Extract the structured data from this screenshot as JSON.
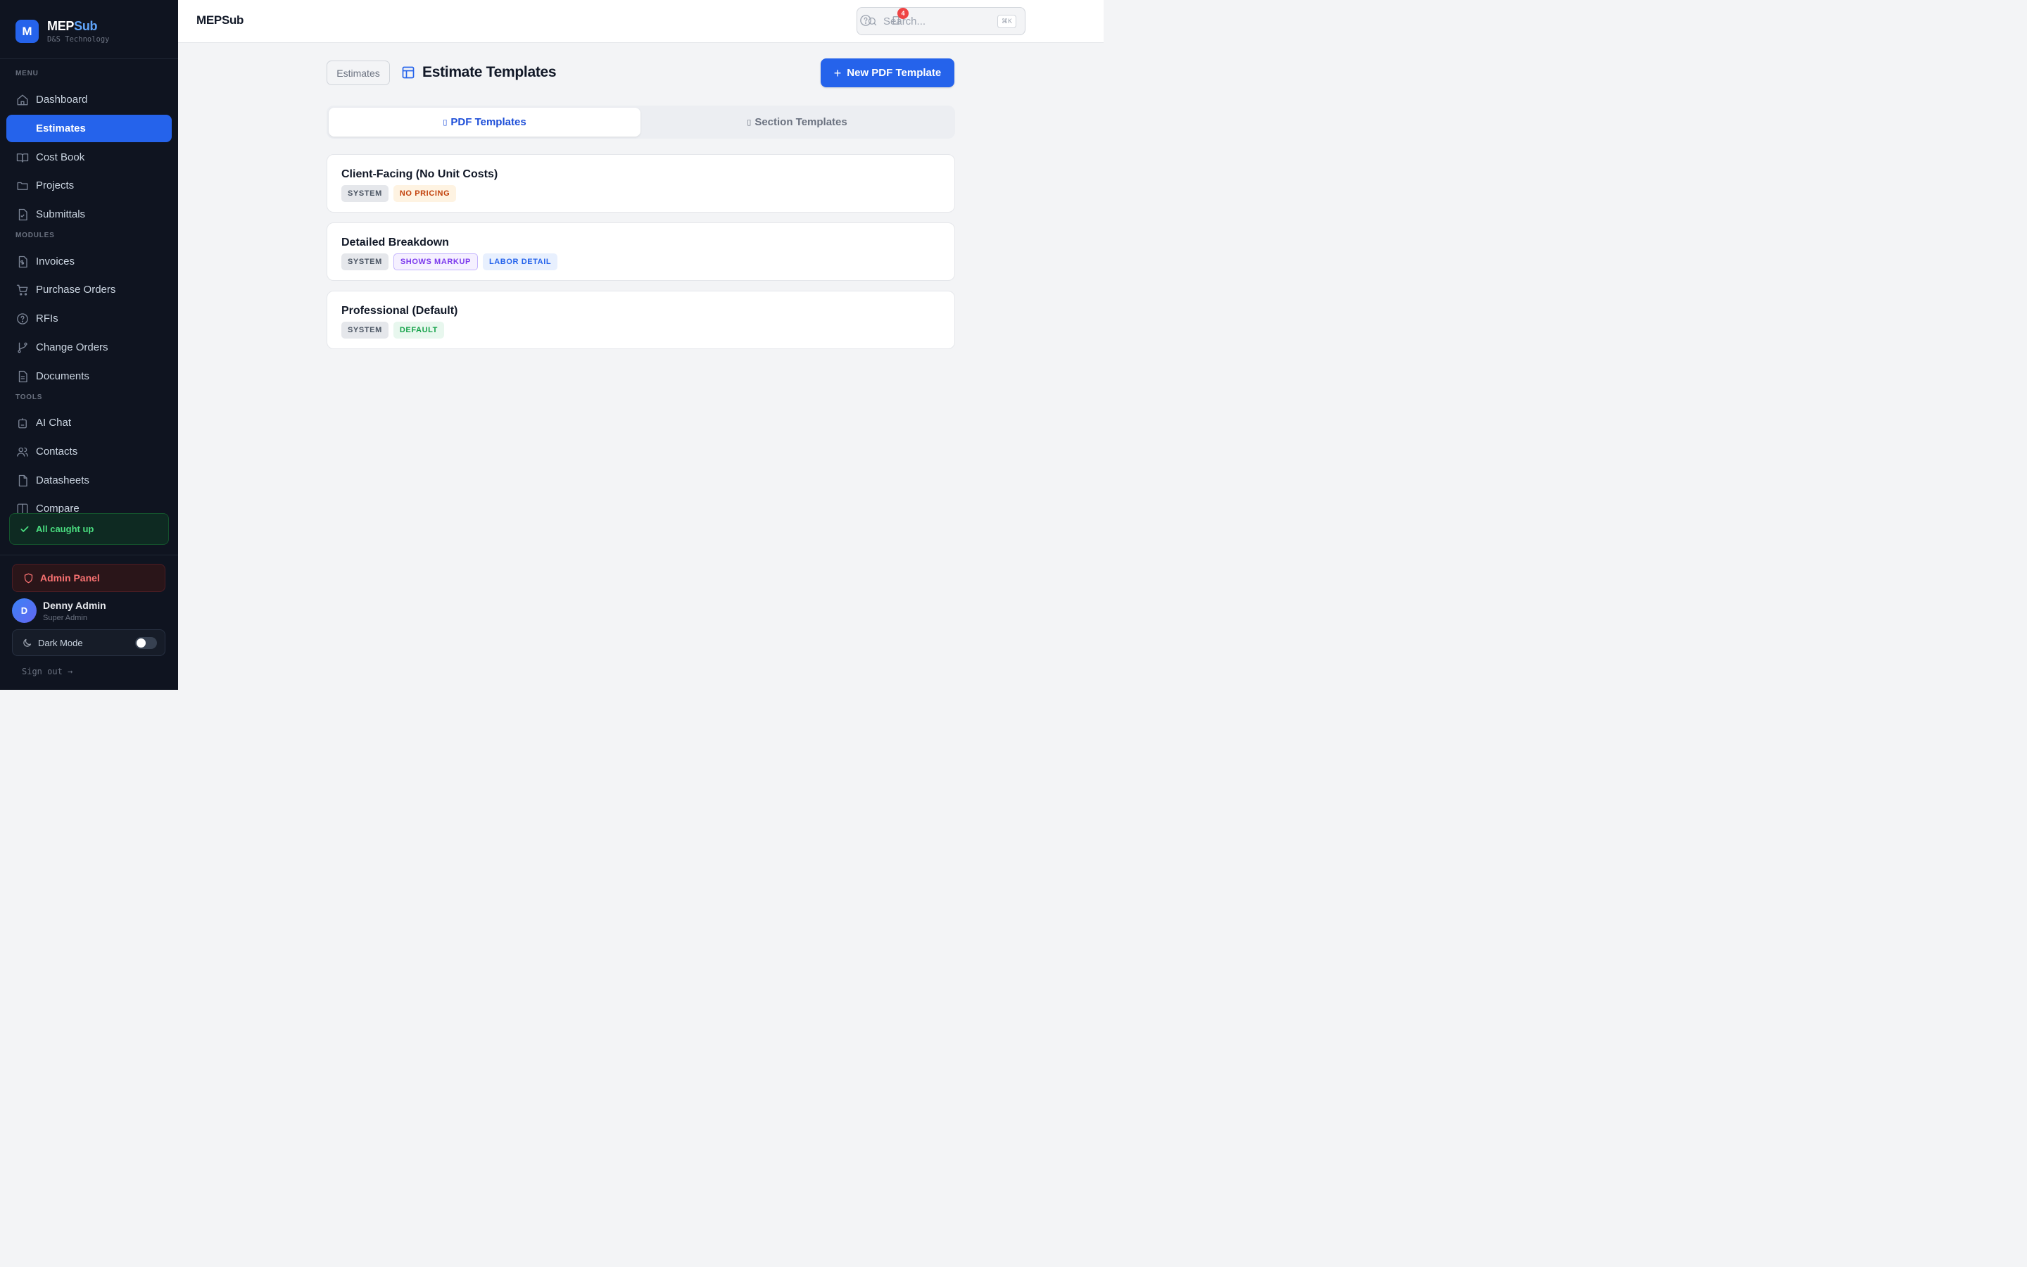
{
  "brand": {
    "logo_letter": "M",
    "name_part1": "MEP",
    "name_part2": "Sub",
    "subtitle": "D&S Technology"
  },
  "sidebar": {
    "section_menu": "MENU",
    "section_modules": "MODULES",
    "section_tools": "TOOLS",
    "menu_items": [
      {
        "label": "Dashboard",
        "icon": "home-icon"
      },
      {
        "label": "Estimates",
        "icon": "calculator-icon",
        "active": true
      },
      {
        "label": "Cost Book",
        "icon": "book-icon"
      },
      {
        "label": "Projects",
        "icon": "folder-icon"
      },
      {
        "label": "Submittals",
        "icon": "file-check-icon"
      }
    ],
    "module_items": [
      {
        "label": "Invoices",
        "icon": "file-dollar-icon"
      },
      {
        "label": "Purchase Orders",
        "icon": "cart-icon"
      },
      {
        "label": "RFIs",
        "icon": "help-circle-icon"
      },
      {
        "label": "Change Orders",
        "icon": "git-branch-icon"
      },
      {
        "label": "Documents",
        "icon": "file-text-icon"
      }
    ],
    "tool_items": [
      {
        "label": "AI Chat",
        "icon": "bot-icon"
      },
      {
        "label": "Contacts",
        "icon": "users-icon"
      },
      {
        "label": "Datasheets",
        "icon": "file-icon"
      },
      {
        "label": "Compare",
        "icon": "columns-icon"
      }
    ],
    "status": "All caught up",
    "admin_panel": "Admin Panel",
    "user": {
      "initial": "D",
      "name": "Denny Admin",
      "role": "Super Admin"
    },
    "dark_mode": {
      "label": "Dark Mode",
      "enabled": false
    },
    "sign_out": "Sign out →"
  },
  "topbar": {
    "title": "MEPSub",
    "search_placeholder": "Search...",
    "search_shortcut": "⌘K",
    "notification_count": "4"
  },
  "main": {
    "breadcrumb": "Estimates",
    "page_title": "Estimate Templates",
    "new_button": "New PDF Template",
    "new_button_icon": "+",
    "tabs": [
      {
        "label": "PDF Templates",
        "icon": "▯",
        "active": true
      },
      {
        "label": "Section Templates",
        "icon": "▯",
        "active": false
      }
    ],
    "templates": [
      {
        "name": "Client-Facing (No Unit Costs)",
        "tags": [
          {
            "label": "SYSTEM",
            "style": "system"
          },
          {
            "label": "NO PRICING",
            "style": "orange"
          }
        ]
      },
      {
        "name": "Detailed Breakdown",
        "tags": [
          {
            "label": "SYSTEM",
            "style": "system"
          },
          {
            "label": "SHOWS MARKUP",
            "style": "purple"
          },
          {
            "label": "LABOR DETAIL",
            "style": "blue"
          }
        ]
      },
      {
        "name": "Professional (Default)",
        "tags": [
          {
            "label": "SYSTEM",
            "style": "system"
          },
          {
            "label": "DEFAULT",
            "style": "green"
          }
        ]
      }
    ]
  },
  "colors": {
    "accent": "#2563eb",
    "sidebar_bg": "#0f1420",
    "success": "#4ade80",
    "danger": "#f87171"
  }
}
